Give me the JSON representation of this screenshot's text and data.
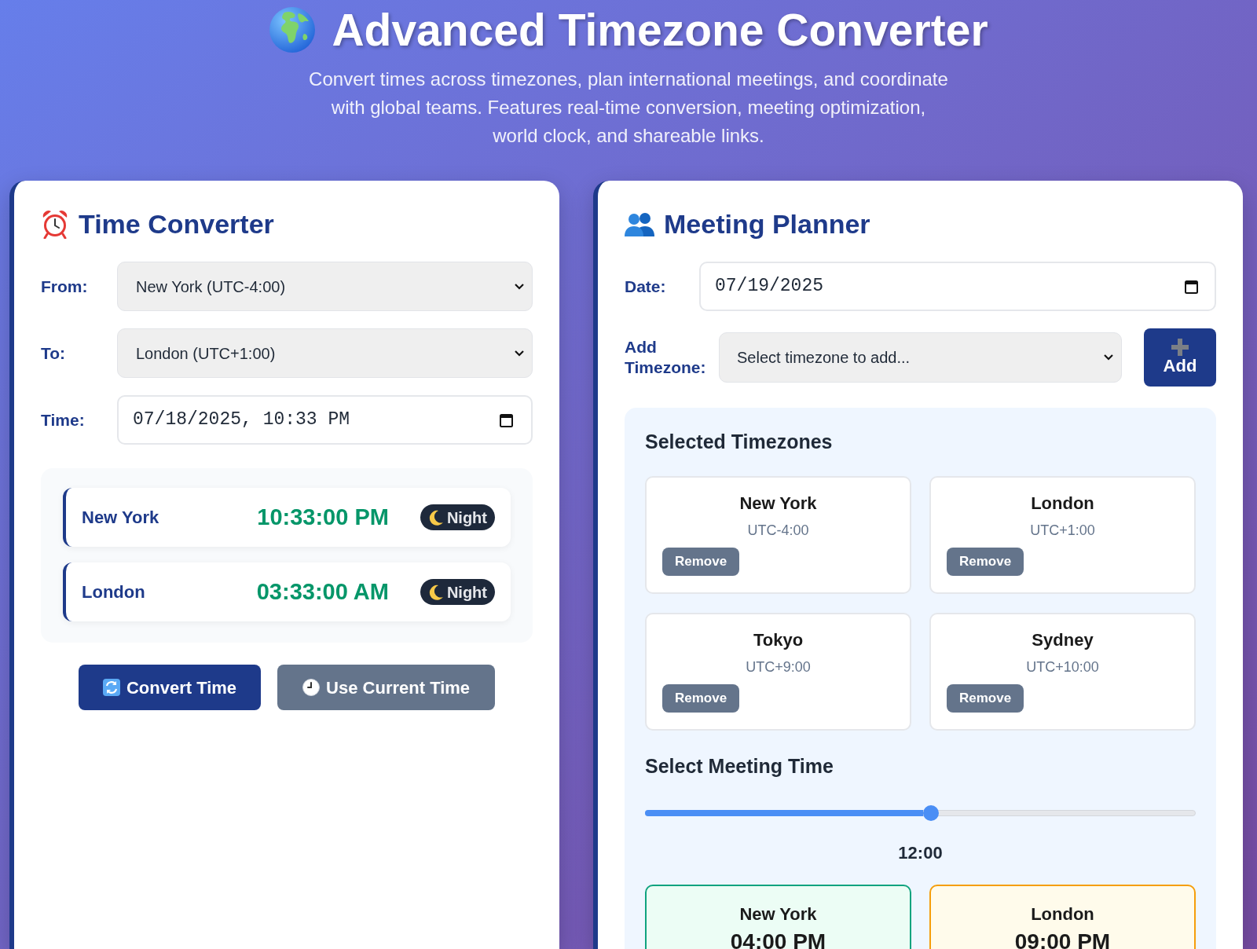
{
  "header": {
    "title": "Advanced Timezone Converter",
    "subtitle": "Convert times across timezones, plan international meetings, and coordinate with global teams. Features real-time conversion, meeting optimization, world clock, and shareable links."
  },
  "time_converter": {
    "title": "Time Converter",
    "fields": [
      {
        "kind": "select",
        "label": "From:",
        "value": "New York (UTC-4:00)"
      },
      {
        "kind": "select",
        "label": "To:",
        "value": "London (UTC+1:00)"
      },
      {
        "kind": "datetime",
        "label": "Time:",
        "value": "07/18/2025, 10:33 PM"
      }
    ],
    "results": [
      {
        "city": "New York",
        "time": "10:33:00 PM",
        "period": {
          "kind": "night",
          "label": "Night"
        }
      },
      {
        "city": "London",
        "time": "03:33:00 AM",
        "period": {
          "kind": "night",
          "label": "Night"
        }
      }
    ],
    "buttons": [
      {
        "kind": "primary",
        "label": "Convert Time"
      },
      {
        "kind": "secondary",
        "label": "Use Current Time"
      }
    ]
  },
  "meeting_planner": {
    "title": "Meeting Planner",
    "date": {
      "label": "Date:",
      "value": "07/19/2025"
    },
    "add_timezone": {
      "label": "Add Timezone:",
      "placeholder": "Select timezone to add...",
      "button": "Add"
    },
    "selected_timezones": {
      "title": "Selected Timezones",
      "items": [
        {
          "name": "New York",
          "offset": "UTC-4:00",
          "button": "Remove"
        },
        {
          "name": "London",
          "offset": "UTC+1:00",
          "button": "Remove"
        },
        {
          "name": "Tokyo",
          "offset": "UTC+9:00",
          "button": "Remove"
        },
        {
          "name": "Sydney",
          "offset": "UTC+10:00",
          "button": "Remove"
        }
      ]
    },
    "meeting_time": {
      "title": "Select Meeting Time",
      "level": 0.52,
      "reading": "12:00"
    },
    "results": [
      {
        "kind": "good",
        "city": "New York",
        "time": "04:00 PM"
      },
      {
        "kind": "fair",
        "city": "London",
        "time": "09:00 PM"
      }
    ]
  }
}
